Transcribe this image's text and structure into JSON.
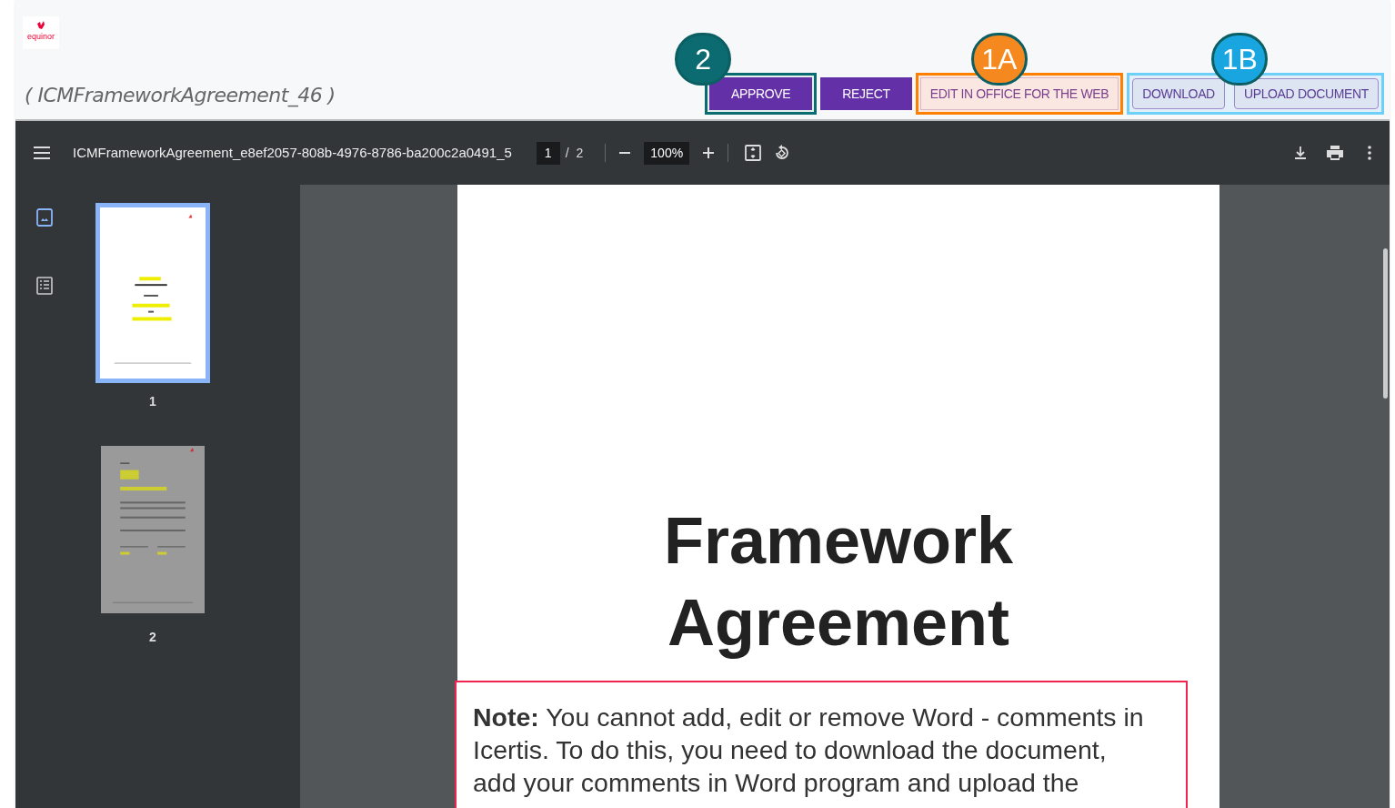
{
  "header": {
    "logo_text": "equinor",
    "title": "( ICMFrameworkAgreement_46 )"
  },
  "action_groups": [
    {
      "callout": {
        "label": "2",
        "color": "#0b6b70"
      },
      "buttons": [
        {
          "label": "APPROVE",
          "kind": "filled"
        }
      ]
    },
    {
      "buttons": [
        {
          "label": "REJECT",
          "kind": "filled"
        }
      ]
    },
    {
      "callout": {
        "label": "1A",
        "color": "#f5891f"
      },
      "buttons": [
        {
          "label": "EDIT IN OFFICE FOR THE WEB",
          "kind": "text"
        }
      ]
    },
    {
      "callout": {
        "label": "1B",
        "color": "#19a6e0"
      },
      "buttons": [
        {
          "label": "DOWNLOAD",
          "kind": "outlined"
        },
        {
          "label": "UPLOAD DOCUMENT",
          "kind": "outlined"
        }
      ]
    }
  ],
  "viewer_toolbar": {
    "filename": "ICMFrameworkAgreement_e8ef2057-808b-4976-8786-ba200c2a0491_5",
    "page_current": "1",
    "page_separator": "/",
    "page_total": "2",
    "zoom": "100%"
  },
  "thumbnails": [
    {
      "label": "1",
      "selected": true
    },
    {
      "label": "2",
      "selected": false
    }
  ],
  "document": {
    "heading": "Framework Agreement",
    "note": "**Note:** You cannot add, edit or remove Word - comments in Icertis. To do this, you need to download the document, add your comments in Word program and upload the"
  }
}
